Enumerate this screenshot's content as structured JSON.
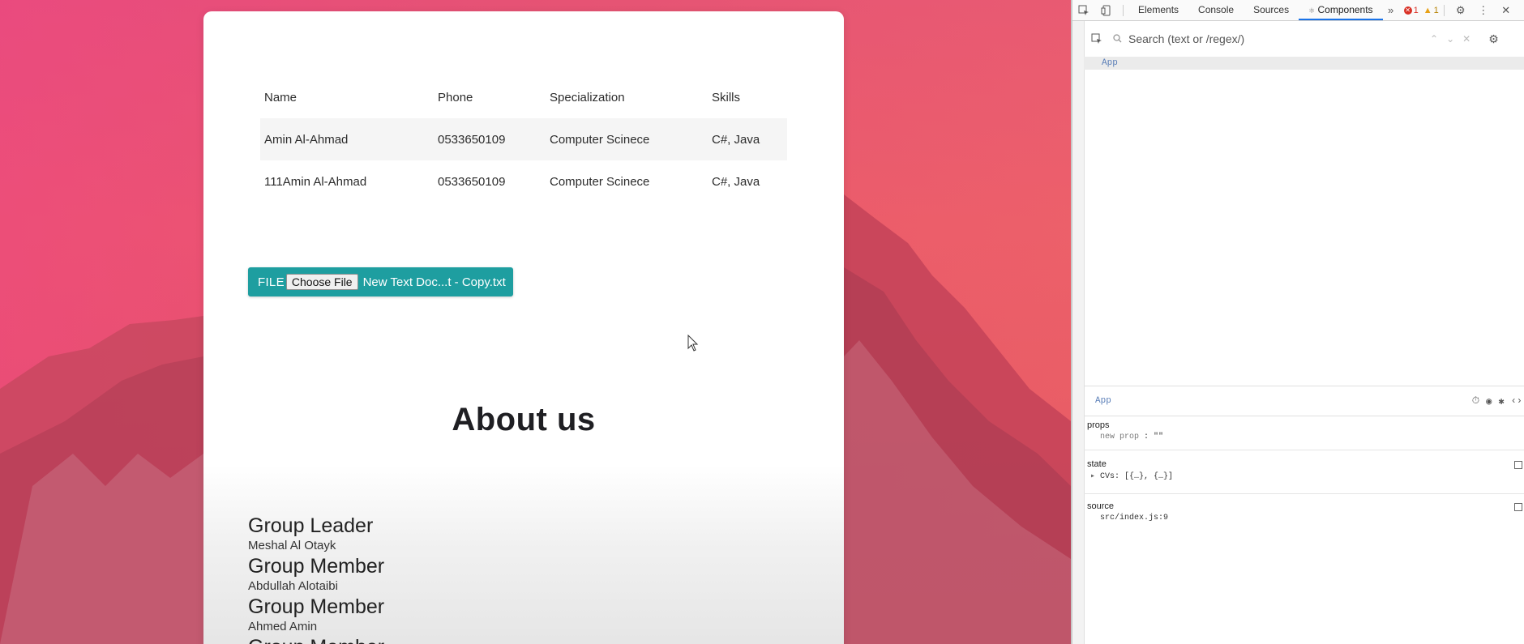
{
  "table": {
    "headers": [
      "Name",
      "Phone",
      "Specialization",
      "Skills"
    ],
    "rows": [
      [
        "Amin Al-Ahmad",
        "0533650109",
        "Computer Scinece",
        "C#, Java"
      ],
      [
        "111Amin Al-Ahmad",
        "0533650109",
        "Computer Scinece",
        "C#, Java"
      ]
    ]
  },
  "file_upload": {
    "label": "FILE",
    "button_label": "Choose File",
    "file_name": "New Text Doc...t - Copy.txt"
  },
  "about": {
    "title": "About us",
    "members": [
      {
        "role": "Group Leader",
        "name": "Meshal Al Otayk"
      },
      {
        "role": "Group Member",
        "name": "Abdullah Alotaibi"
      },
      {
        "role": "Group Member",
        "name": "Ahmed Amin"
      },
      {
        "role": "Group Member",
        "name": ""
      }
    ]
  },
  "devtools": {
    "tabs": [
      "Elements",
      "Console",
      "Sources",
      "Components"
    ],
    "active_tab": "Components",
    "error_count": "1",
    "warning_count": "1",
    "search_placeholder": "Search (text or /regex/)",
    "tree_root": "App",
    "selected_component": "App",
    "props_title": "props",
    "props_row_key": "new prop",
    "props_row_value": ": \"\"",
    "state_title": "state",
    "state_row": "CVs: [{…}, {…}]",
    "source_title": "source",
    "source_row": "src/index.js:9"
  },
  "colors": {
    "file_button_bg": "#1e9ea0",
    "active_tab_underline": "#1a73e8",
    "component_name": "#5b7fb8"
  }
}
